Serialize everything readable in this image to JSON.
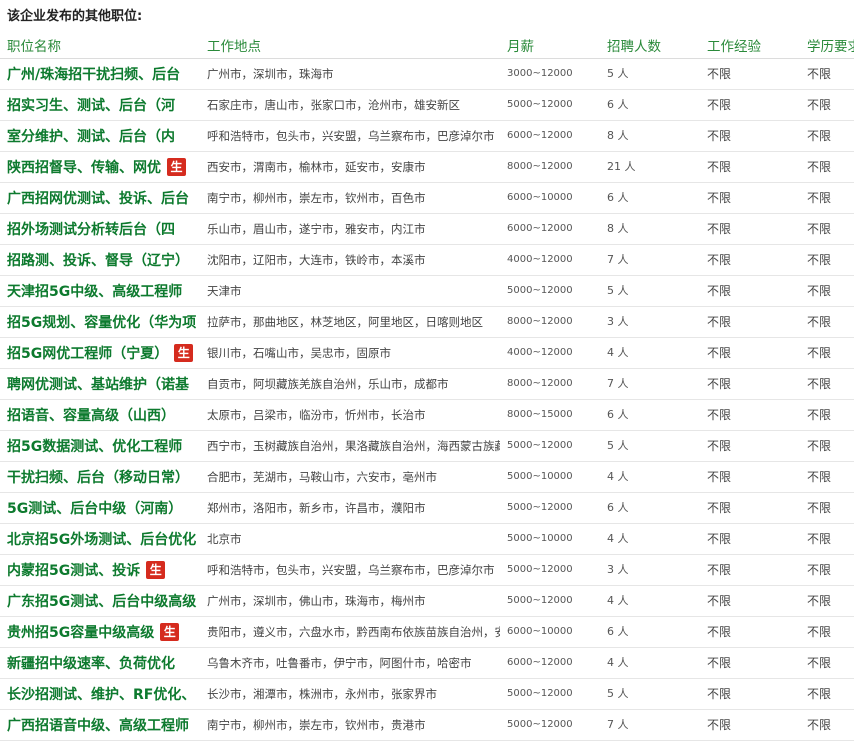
{
  "section_title": "该企业发布的其他职位:",
  "columns": [
    "职位名称",
    "工作地点",
    "月薪",
    "招聘人数",
    "工作经验",
    "学历要求"
  ],
  "badge_label": "生",
  "rows": [
    {
      "title": "广州/珠海招干扰扫频、后台",
      "location": "广州市，深圳市，珠海市",
      "salary": "3000~12000",
      "count": "5 人",
      "experience": "不限",
      "education": "不限",
      "badge": false
    },
    {
      "title": "招实习生、测试、后台（河",
      "location": "石家庄市，唐山市，张家口市，沧州市，雄安新区",
      "salary": "5000~12000",
      "count": "6 人",
      "experience": "不限",
      "education": "不限",
      "badge": false
    },
    {
      "title": "室分维护、测试、后台（内",
      "location": "呼和浩特市，包头市，兴安盟，乌兰察布市，巴彦淖尔市",
      "salary": "6000~12000",
      "count": "8 人",
      "experience": "不限",
      "education": "不限",
      "badge": false
    },
    {
      "title": "陕西招督导、传输、网优",
      "location": "西安市，渭南市，榆林市，延安市，安康市",
      "salary": "8000~12000",
      "count": "21 人",
      "experience": "不限",
      "education": "不限",
      "badge": true
    },
    {
      "title": "广西招网优测试、投诉、后台",
      "location": "南宁市，柳州市，崇左市，钦州市，百色市",
      "salary": "6000~10000",
      "count": "6 人",
      "experience": "不限",
      "education": "不限",
      "badge": false
    },
    {
      "title": "招外场测试分析转后台（四",
      "location": "乐山市，眉山市，遂宁市，雅安市，内江市",
      "salary": "6000~12000",
      "count": "8 人",
      "experience": "不限",
      "education": "不限",
      "badge": false
    },
    {
      "title": "招路测、投诉、督导（辽宁）",
      "location": "沈阳市，辽阳市，大连市，铁岭市，本溪市",
      "salary": "4000~12000",
      "count": "7 人",
      "experience": "不限",
      "education": "不限",
      "badge": false
    },
    {
      "title": "天津招5G中级、高级工程师",
      "location": "天津市",
      "salary": "5000~12000",
      "count": "5 人",
      "experience": "不限",
      "education": "不限",
      "badge": false
    },
    {
      "title": "招5G规划、容量优化（华为项",
      "location": "拉萨市，那曲地区，林芝地区，阿里地区，日喀则地区",
      "salary": "8000~12000",
      "count": "3 人",
      "experience": "不限",
      "education": "不限",
      "badge": false
    },
    {
      "title": "招5G网优工程师（宁夏）",
      "location": "银川市，石嘴山市，吴忠市，固原市",
      "salary": "4000~12000",
      "count": "4 人",
      "experience": "不限",
      "education": "不限",
      "badge": true
    },
    {
      "title": "聘网优测试、基站维护（诺基",
      "location": "自贡市，阿坝藏族羌族自治州，乐山市，成都市",
      "salary": "8000~12000",
      "count": "7 人",
      "experience": "不限",
      "education": "不限",
      "badge": false
    },
    {
      "title": "招语音、容量高级（山西）",
      "location": "太原市，吕梁市，临汾市，忻州市，长治市",
      "salary": "8000~15000",
      "count": "6 人",
      "experience": "不限",
      "education": "不限",
      "badge": false
    },
    {
      "title": "招5G数据测试、优化工程师",
      "location": "西宁市，玉树藏族自治州，果洛藏族自治州，海西蒙古族藏",
      "salary": "5000~12000",
      "count": "5 人",
      "experience": "不限",
      "education": "不限",
      "badge": false
    },
    {
      "title": "干扰扫频、后台（移动日常）",
      "location": "合肥市，芜湖市，马鞍山市，六安市，亳州市",
      "salary": "5000~10000",
      "count": "4 人",
      "experience": "不限",
      "education": "不限",
      "badge": false
    },
    {
      "title": "5G测试、后台中级（河南）",
      "location": "郑州市，洛阳市，新乡市，许昌市，濮阳市",
      "salary": "5000~12000",
      "count": "6 人",
      "experience": "不限",
      "education": "不限",
      "badge": false
    },
    {
      "title": "北京招5G外场测试、后台优化",
      "location": "北京市",
      "salary": "5000~10000",
      "count": "4 人",
      "experience": "不限",
      "education": "不限",
      "badge": false
    },
    {
      "title": "内蒙招5G测试、投诉",
      "location": "呼和浩特市，包头市，兴安盟，乌兰察布市，巴彦淖尔市",
      "salary": "5000~12000",
      "count": "3 人",
      "experience": "不限",
      "education": "不限",
      "badge": true
    },
    {
      "title": "广东招5G测试、后台中级高级",
      "location": "广州市，深圳市，佛山市，珠海市，梅州市",
      "salary": "5000~12000",
      "count": "4 人",
      "experience": "不限",
      "education": "不限",
      "badge": false
    },
    {
      "title": "贵州招5G容量中级高级",
      "location": "贵阳市，遵义市，六盘水市，黔西南布依族苗族自治州，安顺",
      "salary": "6000~10000",
      "count": "6 人",
      "experience": "不限",
      "education": "不限",
      "badge": true
    },
    {
      "title": "新疆招中级速率、负荷优化",
      "location": "乌鲁木齐市，吐鲁番市，伊宁市，阿图什市，哈密市",
      "salary": "6000~12000",
      "count": "4 人",
      "experience": "不限",
      "education": "不限",
      "badge": false
    },
    {
      "title": "长沙招测试、维护、RF优化、",
      "location": "长沙市，湘潭市，株洲市，永州市，张家界市",
      "salary": "5000~12000",
      "count": "5 人",
      "experience": "不限",
      "education": "不限",
      "badge": false
    },
    {
      "title": "广西招语音中级、高级工程师",
      "location": "南宁市，柳州市，崇左市，钦州市，贵港市",
      "salary": "5000~12000",
      "count": "7 人",
      "experience": "不限",
      "education": "不限",
      "badge": false
    }
  ]
}
